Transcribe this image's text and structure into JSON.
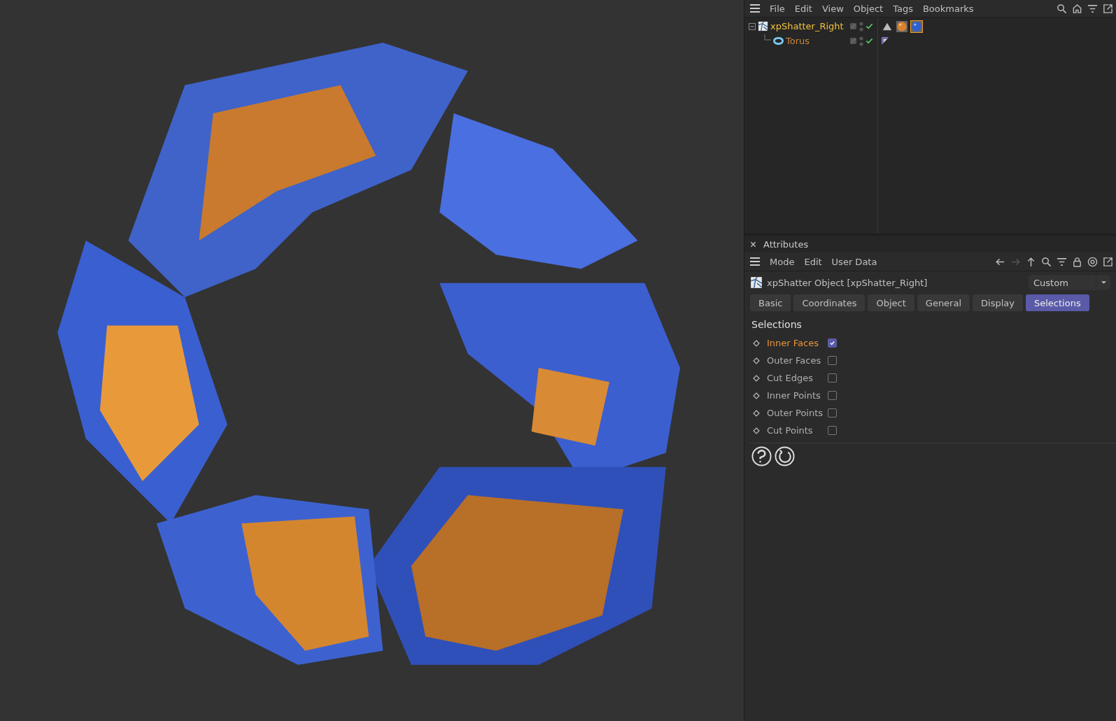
{
  "object_manager": {
    "menu": [
      "File",
      "Edit",
      "View",
      "Object",
      "Tags",
      "Bookmarks"
    ],
    "objects": [
      {
        "name": "xpShatter_Right",
        "selected": true,
        "kind": "shatter",
        "tags": [
          {
            "kind": "phong",
            "selected": false
          },
          {
            "kind": "material",
            "color": "#d9822b",
            "selected": false
          },
          {
            "kind": "material",
            "color": "#2f5fd0",
            "selected": true
          }
        ],
        "children": [
          {
            "name": "Torus",
            "selected": false,
            "kind": "torus",
            "tags": [
              {
                "kind": "selection",
                "selected": false
              }
            ]
          }
        ]
      }
    ]
  },
  "attributes": {
    "title": "Attributes",
    "menu": [
      "Mode",
      "Edit",
      "User Data"
    ],
    "object_label": "xpShatter Object [xpShatter_Right]",
    "layout_dropdown": "Custom",
    "tabs": [
      {
        "label": "Basic",
        "selected": false
      },
      {
        "label": "Coordinates",
        "selected": false
      },
      {
        "label": "Object",
        "selected": false
      },
      {
        "label": "General",
        "selected": false
      },
      {
        "label": "Display",
        "selected": false
      },
      {
        "label": "Selections",
        "selected": true
      }
    ],
    "section": "Selections",
    "params": [
      {
        "label": "Inner Faces",
        "checked": true
      },
      {
        "label": "Outer Faces",
        "checked": false
      },
      {
        "label": "Cut Edges",
        "checked": false
      },
      {
        "label": "Inner Points",
        "checked": false
      },
      {
        "label": "Outer Points",
        "checked": false
      },
      {
        "label": "Cut Points",
        "checked": false
      }
    ]
  }
}
